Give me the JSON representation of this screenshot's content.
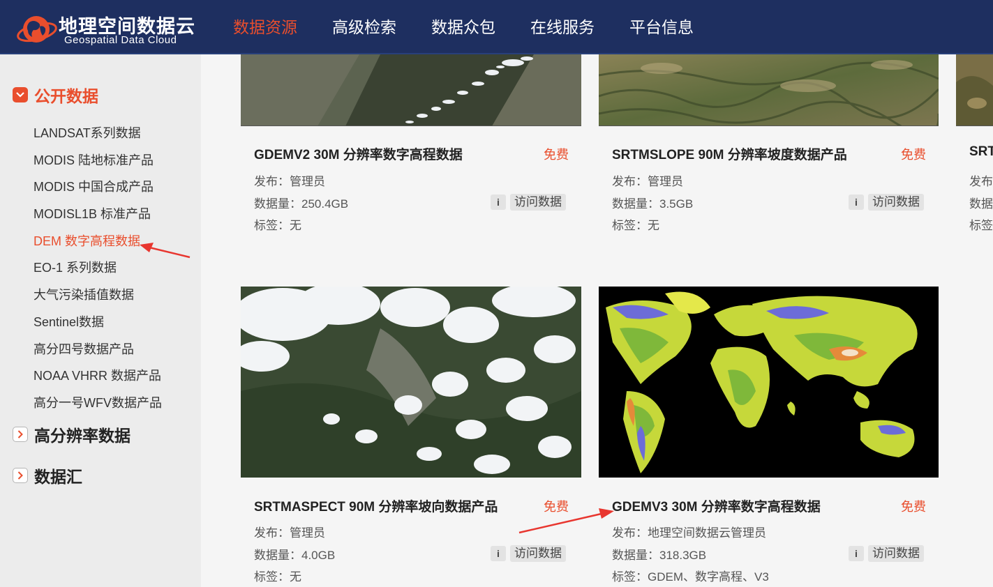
{
  "header": {
    "logo_cn": "地理空间数据云",
    "logo_en": "Geospatial Data Cloud",
    "nav": [
      "数据资源",
      "高级检索",
      "数据众包",
      "在线服务",
      "平台信息"
    ],
    "active_nav": "数据资源"
  },
  "sidebar": {
    "categories": [
      {
        "label": "公开数据",
        "expanded": true,
        "items": [
          "LANDSAT系列数据",
          "MODIS 陆地标准产品",
          "MODIS 中国合成产品",
          "MODISL1B 标准产品",
          "DEM 数字高程数据",
          "EO-1 系列数据",
          "大气污染插值数据",
          "Sentinel数据",
          "高分四号数据产品",
          "NOAA VHRR 数据产品",
          "高分一号WFV数据产品"
        ],
        "active_item": "DEM 数字高程数据"
      },
      {
        "label": "高分辨率数据",
        "expanded": false
      },
      {
        "label": "数据汇",
        "expanded": false
      }
    ]
  },
  "cards": [
    {
      "title": "GDEMV2 30M 分辨率数字高程数据",
      "price": "免费",
      "publisher": "发布：管理员",
      "size": "数据量：250.4GB",
      "tags": "标签：无",
      "info": "i",
      "visit": "访问数据"
    },
    {
      "title": "SRTMSLOPE 90M 分辨率坡度数据产品",
      "price": "免费",
      "publisher": "发布：管理员",
      "size": "数据量：3.5GB",
      "tags": "标签：无",
      "info": "i",
      "visit": "访问数据"
    },
    {
      "title": "SRT",
      "publisher": "发布",
      "size": "数据",
      "tags": "标签"
    },
    {
      "title": "SRTMASPECT 90M 分辨率坡向数据产品",
      "price": "免费",
      "publisher": "发布：管理员",
      "size": "数据量：4.0GB",
      "tags": "标签：无",
      "info": "i",
      "visit": "访问数据"
    },
    {
      "title": "GDEMV3 30M 分辨率数字高程数据",
      "price": "免费",
      "publisher": "发布：地理空间数据云管理员",
      "size": "数据量：318.3GB",
      "tags": "标签：GDEM、数字高程、V3",
      "info": "i",
      "visit": "访问数据"
    }
  ],
  "colors": {
    "header_bg": "#1e2f60",
    "accent": "#e94e2d",
    "sidebar_bg": "#ececec",
    "content_bg": "#f5f5f5"
  },
  "icons": [
    "globe-logo-icon",
    "chevron-down-icon",
    "chevron-right-icon",
    "info-icon",
    "annotation-arrow-icon"
  ]
}
